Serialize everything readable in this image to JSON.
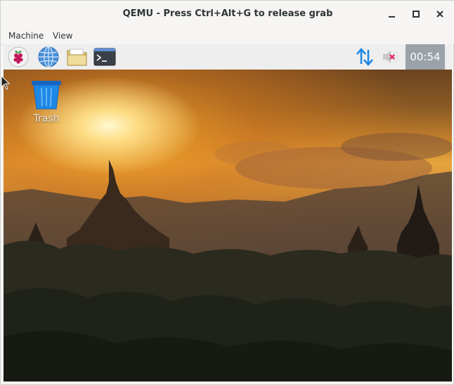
{
  "window": {
    "title": "QEMU - Press Ctrl+Alt+G to release grab",
    "controls": [
      "minimize-icon",
      "maximize-icon",
      "close-icon"
    ]
  },
  "menubar": {
    "items": [
      "Machine",
      "View"
    ]
  },
  "taskbar": {
    "launchers": [
      {
        "name": "raspberry-menu",
        "icon": "raspberry-icon"
      },
      {
        "name": "web-browser",
        "icon": "globe-icon"
      },
      {
        "name": "file-manager",
        "icon": "folder-icon"
      },
      {
        "name": "terminal",
        "icon": "terminal-icon"
      }
    ],
    "tray": {
      "network_icon": "network-arrows-icon",
      "volume_icon": "volume-muted-icon",
      "clock": "00:54"
    },
    "colors": {
      "taskbar_bg": "#eeeeee",
      "clock_bg": "#9aa3aa",
      "network": "#1e88e5",
      "muted": "#e0245e"
    }
  },
  "desktop": {
    "icons": [
      {
        "label": "Trash",
        "icon": "trash-icon"
      }
    ],
    "wallpaper": "sunset over temples"
  }
}
